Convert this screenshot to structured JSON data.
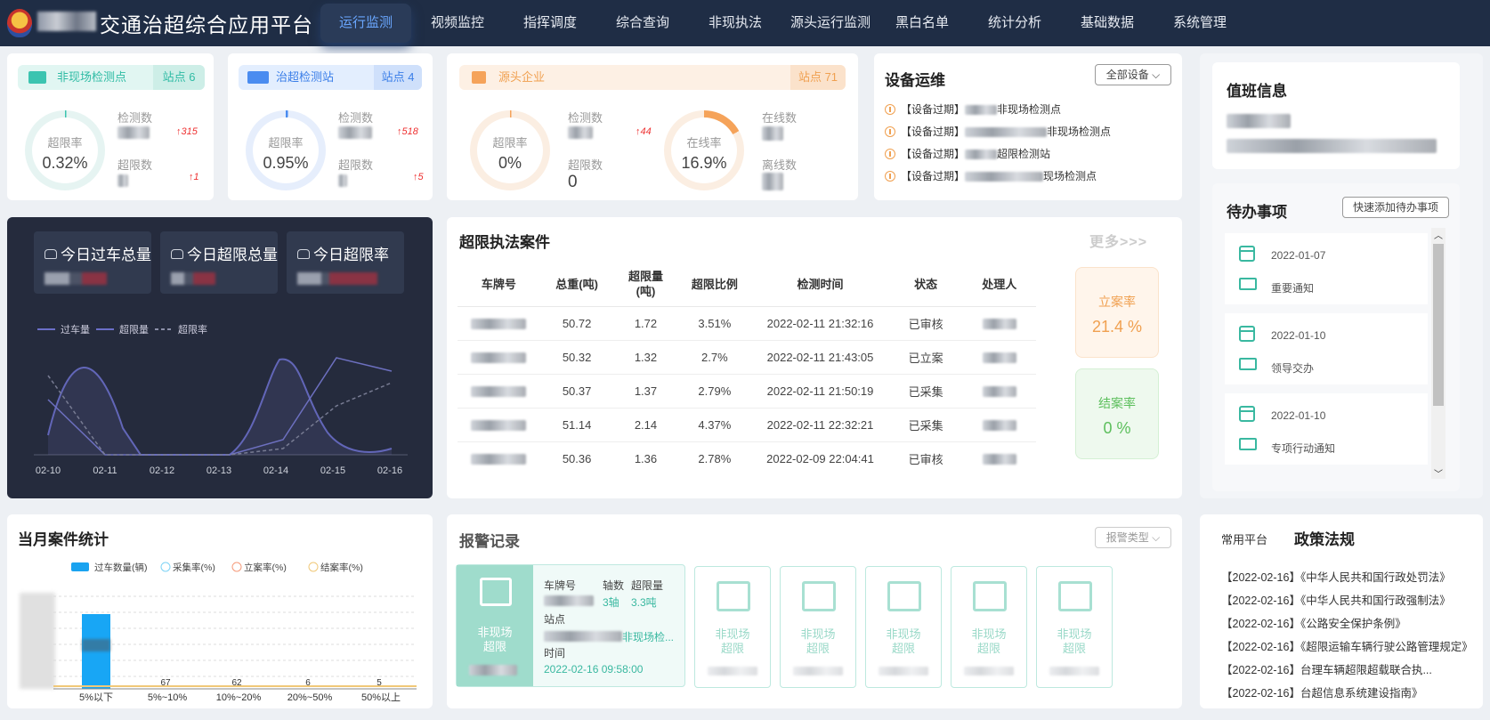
{
  "header": {
    "title": "交通治超综合应用平台",
    "nav": [
      "运行监测",
      "视频监控",
      "指挥调度",
      "综合查询",
      "非现执法",
      "源头运行监测",
      "黑白名单",
      "统计分析",
      "基础数据",
      "系统管理"
    ]
  },
  "stats": [
    {
      "tag": "非现场检测点",
      "badge": "站点 6",
      "rate_label": "超限率",
      "rate": "0.32%",
      "rate_fraction": 0.0032,
      "l1": "检测数",
      "l2": "超限数",
      "up1": "315",
      "up2": "1",
      "color": "#3cc4b0"
    },
    {
      "tag": "治超检测站",
      "badge": "站点 4",
      "rate_label": "超限率",
      "rate": "0.95%",
      "rate_fraction": 0.0095,
      "l1": "检测数",
      "l2": "超限数",
      "up1": "518",
      "up2": "5",
      "color": "#4a8cf0"
    },
    {
      "tag": "源头企业",
      "badge": "站点 71",
      "rate_label": "超限率",
      "rate": "0%",
      "l1": "检测数",
      "l2": "超限数",
      "v2": "0",
      "up1": "44",
      "rate2_label": "在线率",
      "rate2": "16.9%",
      "rate2_fraction": 0.169,
      "l3": "在线数",
      "l4": "离线数",
      "color": "#f5a35a"
    }
  ],
  "devices": {
    "title": "设备运维",
    "filter": "全部设备",
    "items": [
      "【设备过期】",
      "【设备过期】",
      "【设备过期】",
      "【设备过期】"
    ],
    "names": [
      "非现场检测点",
      "非现场检测点",
      "超限检测站",
      "现场检测点"
    ]
  },
  "duty": {
    "title": "值班信息"
  },
  "todo": {
    "title": "待办事项",
    "add": "快速添加待办事项",
    "items": [
      {
        "date": "2022-01-07",
        "text": "重要通知"
      },
      {
        "date": "2022-01-10",
        "text": "领导交办"
      },
      {
        "date": "2022-01-10",
        "text": "专项行动通知"
      }
    ]
  },
  "today": {
    "k1": "今日过车总量",
    "k2": "今日超限总量",
    "k3": "今日超限率",
    "legend": [
      "过车量",
      "超限量",
      "超限率"
    ],
    "x": [
      "02-10",
      "02-11",
      "02-12",
      "02-13",
      "02-14",
      "02-15",
      "02-16"
    ]
  },
  "cases": {
    "title": "超限执法案件",
    "more": "更多>>>",
    "cols": [
      "车牌号",
      "总重(吨)",
      "超限量\n(吨)",
      "超限比例",
      "检测时间",
      "状态",
      "处理人"
    ],
    "rows": [
      [
        "50.72",
        "1.72",
        "3.51%",
        "2022-02-11 21:32:16",
        "已审核"
      ],
      [
        "50.32",
        "1.32",
        "2.7%",
        "2022-02-11 21:43:05",
        "已立案"
      ],
      [
        "50.37",
        "1.37",
        "2.79%",
        "2022-02-11 21:50:19",
        "已采集"
      ],
      [
        "51.14",
        "2.14",
        "4.37%",
        "2022-02-11 22:32:21",
        "已采集"
      ],
      [
        "50.36",
        "1.36",
        "2.78%",
        "2022-02-09 22:04:41",
        "已审核"
      ]
    ],
    "r1_label": "立案率",
    "r1": "21.4 %",
    "r2_label": "结案率",
    "r2": "0 %"
  },
  "monthly": {
    "title": "当月案件统计",
    "legend": [
      "过车数量(辆)",
      "采集率(%)",
      "立案率(%)",
      "结案率(%)"
    ],
    "x": [
      "5%以下",
      "5%~10%",
      "10%~20%",
      "20%~50%",
      "50%以上"
    ],
    "small": [
      "67",
      "62",
      "6",
      "5"
    ]
  },
  "alarms": {
    "title": "报警记录",
    "filter": "报警类型",
    "type": "非现场\n超限",
    "plate_label": "车牌号",
    "axle_label": "轴数",
    "over_label": "超限量",
    "axle": "3轴",
    "over": "3.3吨",
    "site_label": "站点",
    "site": "非现场检...",
    "time_label": "时间",
    "time": "2022-02-16 09:58:00",
    "cards": 5
  },
  "policy": {
    "tab1": "常用平台",
    "tab2": "政策法规",
    "items": [
      "【2022-02-16】《中华人民共和国行政处罚法》",
      "【2022-02-16】《中华人民共和国行政强制法》",
      "【2022-02-16】《公路安全保护条例》",
      "【2022-02-16】《超限运输车辆行驶公路管理规定》",
      "【2022-02-16】台理车辆超限超载联合执...",
      "【2022-02-16】台超信息系统建设指南》"
    ]
  }
}
